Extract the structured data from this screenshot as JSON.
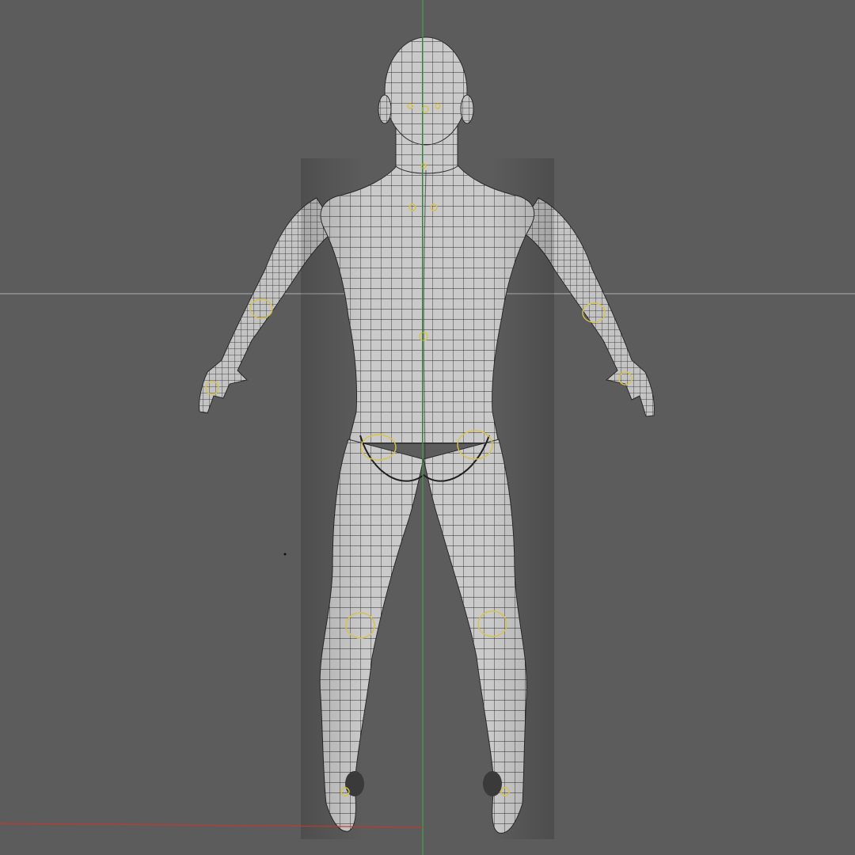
{
  "viewport": {
    "background_color": "#5c5c5c",
    "view": "back",
    "mode": "wireframe-on-shaded"
  },
  "axes": {
    "vertical_axis_color": "#3fa34a",
    "horizontal_axis_color": "#b8b8b8",
    "x_axis_color": "#c0392b"
  },
  "model": {
    "subject": "human-male-base-mesh",
    "surface_color": "#c9c9c9",
    "wire_color": "#2a2a2a",
    "rig_marker_color": "#d8c24a"
  }
}
